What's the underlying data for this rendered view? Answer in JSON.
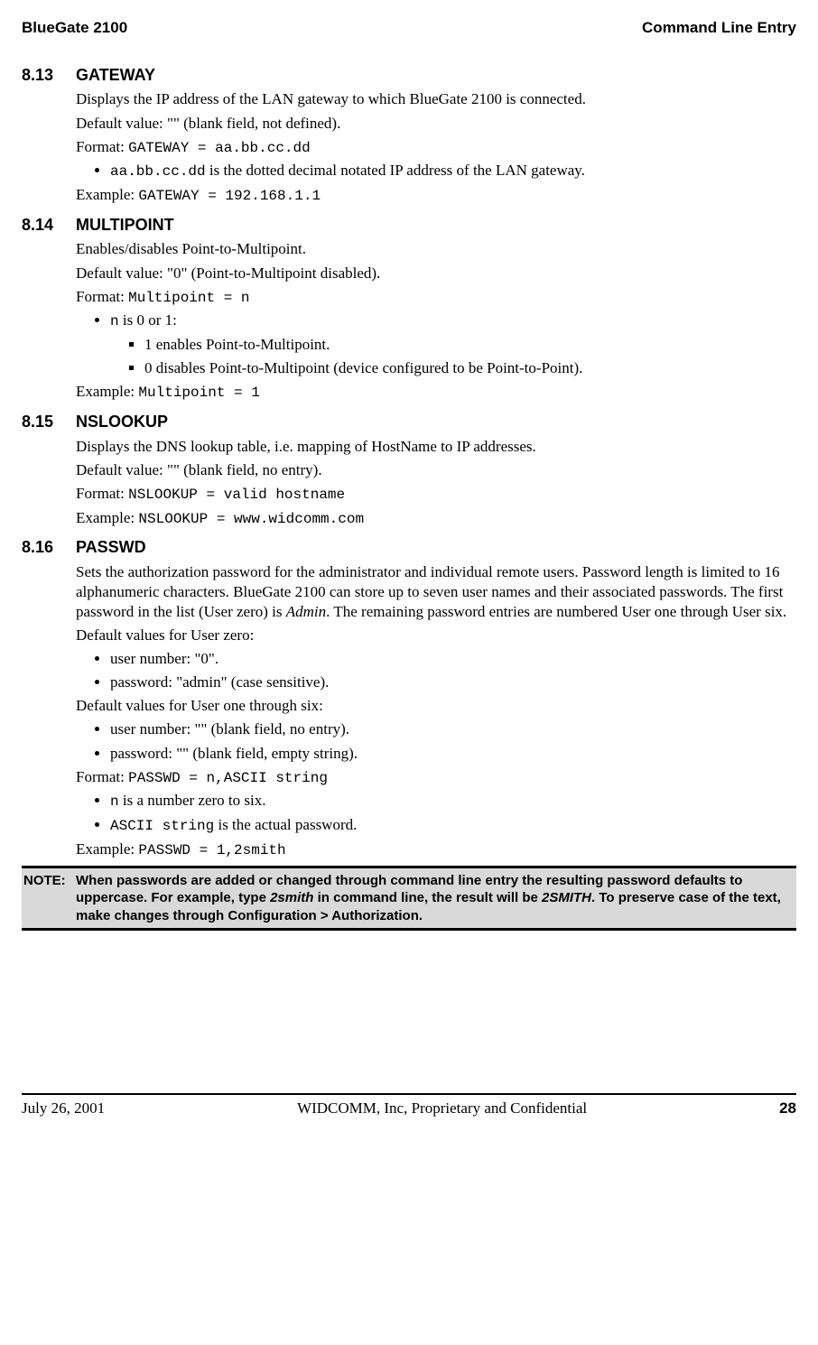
{
  "header": {
    "left": "BlueGate 2100",
    "right": "Command Line Entry"
  },
  "s813": {
    "num": "8.13",
    "title": "GATEWAY",
    "p1": "Displays the IP address of the LAN gateway to which BlueGate 2100 is connected.",
    "p2": "Default value: \"\" (blank field, not defined).",
    "fmt_lbl": "Format: ",
    "fmt_val": "GATEWAY = aa.bb.cc.dd",
    "b1_code": "aa.bb.cc.dd",
    "b1_rest": " is the dotted decimal notated IP address of the LAN gateway.",
    "ex_lbl": "Example: ",
    "ex_val": "GATEWAY = 192.168.1.1"
  },
  "s814": {
    "num": "8.14",
    "title": "MULTIPOINT",
    "p1": "Enables/disables Point-to-Multipoint.",
    "p2": "Default value: \"0\" (Point-to-Multipoint disabled).",
    "fmt_lbl": "Format: ",
    "fmt_val": "Multipoint = n",
    "b1_code": "n",
    "b1_rest": " is 0 or 1:",
    "sb1": "1 enables Point-to-Multipoint.",
    "sb2": "0 disables Point-to-Multipoint (device configured to be Point-to-Point).",
    "ex_lbl": "Example: ",
    "ex_val": "Multipoint = 1"
  },
  "s815": {
    "num": "8.15",
    "title": "NSLOOKUP",
    "p1": "Displays the DNS lookup table, i.e. mapping of HostName to IP addresses.",
    "p2": "Default value: \"\" (blank field, no entry).",
    "fmt_lbl": "Format: ",
    "fmt_val": "NSLOOKUP = valid hostname",
    "ex_lbl": "Example: ",
    "ex_val": "NSLOOKUP = www.widcomm.com"
  },
  "s816": {
    "num": "8.16",
    "title": "PASSWD",
    "p1a": "Sets the authorization password for the administrator and individual remote users. Password length is limited to 16 alphanumeric characters. BlueGate 2100 can store up to seven user names and their associated passwords. The first password in the list (User zero) is ",
    "p1b": "Admin",
    "p1c": ". The remaining password entries are numbered User one through User six.",
    "p2": "Default values for User zero:",
    "b0a": "user number: \"0\".",
    "b0b": "password: \"admin\" (case sensitive).",
    "p3": "Default values for User one through six:",
    "b1a": "user number: \"\" (blank field, no entry).",
    "b1b": "password: \"\" (blank field, empty string).",
    "fmt_lbl": "Format:  ",
    "fmt_val": "PASSWD = n,ASCII string",
    "bn_code": "n",
    "bn_rest": " is a number zero to six.",
    "ba_code": "ASCII string",
    "ba_rest": " is the actual password.",
    "ex_lbl": "Example: ",
    "ex_val": "PASSWD = 1,2smith"
  },
  "note": {
    "label": "NOTE:",
    "t1": "When passwords are added or changed through command line entry the resulting password defaults to uppercase. For example, type ",
    "e1": "2smith",
    "t2": " in command line, the result will be ",
    "e2": "2SMITH",
    "t3": ". To preserve case of the text, make changes through Configuration > Authorization."
  },
  "footer": {
    "date": "July 26, 2001",
    "center": "WIDCOMM, Inc, Proprietary and Confidential",
    "page": "28"
  }
}
